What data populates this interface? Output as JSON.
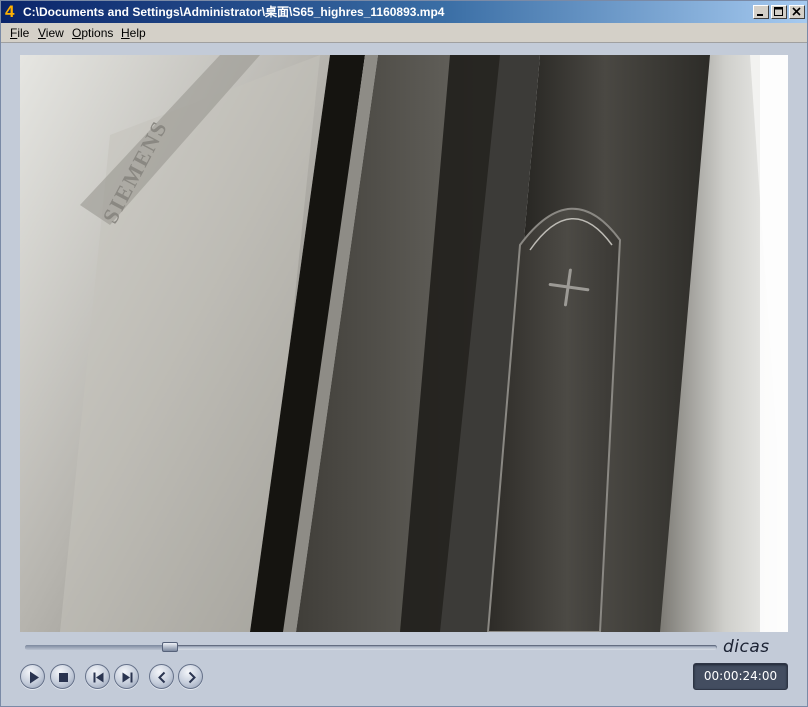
{
  "window": {
    "app_icon_glyph": "4",
    "title": "C:\\Documents and Settings\\Administrator\\桌面\\S65_highres_1160893.mp4",
    "buttons": [
      "minimize-icon",
      "maximize-icon",
      "close-icon"
    ]
  },
  "menu": {
    "items": [
      {
        "label": "File"
      },
      {
        "label": "View"
      },
      {
        "label": "Options"
      },
      {
        "label": "Help"
      }
    ]
  },
  "video": {
    "content": "close-up of mobile phone with volume plus key",
    "brand_on_device": "SIEMENS"
  },
  "player": {
    "brand": "dicas",
    "time": "00:00:24:00",
    "progress_fraction": 0.21,
    "controls": [
      "play-icon",
      "stop-icon",
      "skip-previous-icon",
      "skip-next-icon",
      "step-back-icon",
      "step-forward-icon"
    ]
  },
  "colors": {
    "title_bar_start": "#0a246a",
    "title_bar_end": "#a6caf0",
    "panel": "#c3cbd8",
    "time_display": "#434d60"
  }
}
